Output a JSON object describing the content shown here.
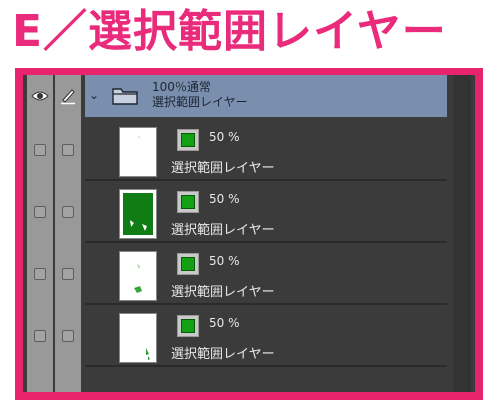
{
  "title": "E／選択範囲レイヤー",
  "header": {
    "mode_line": "100％通常",
    "folder_name": "選択範囲レイヤー"
  },
  "layers": [
    {
      "opacity": "50 %",
      "name": "選択範囲レイヤー"
    },
    {
      "opacity": "50 %",
      "name": "選択範囲レイヤー"
    },
    {
      "opacity": "50 %",
      "name": "選択範囲レイヤー"
    },
    {
      "opacity": "50 %",
      "name": "選択範囲レイヤー"
    }
  ],
  "icons": {
    "visibility": "eye-icon",
    "lock": "pen-icon",
    "expand": "chevron-down-icon",
    "folder": "folder-icon",
    "layer_color": "green-chip-icon"
  },
  "colors": {
    "accent_title": "#ea2a7a",
    "frame": "#e8246e",
    "panel_bg": "#3b3b3b",
    "selected_row": "#7a8fae",
    "layer_color_chip": "#14a014"
  }
}
